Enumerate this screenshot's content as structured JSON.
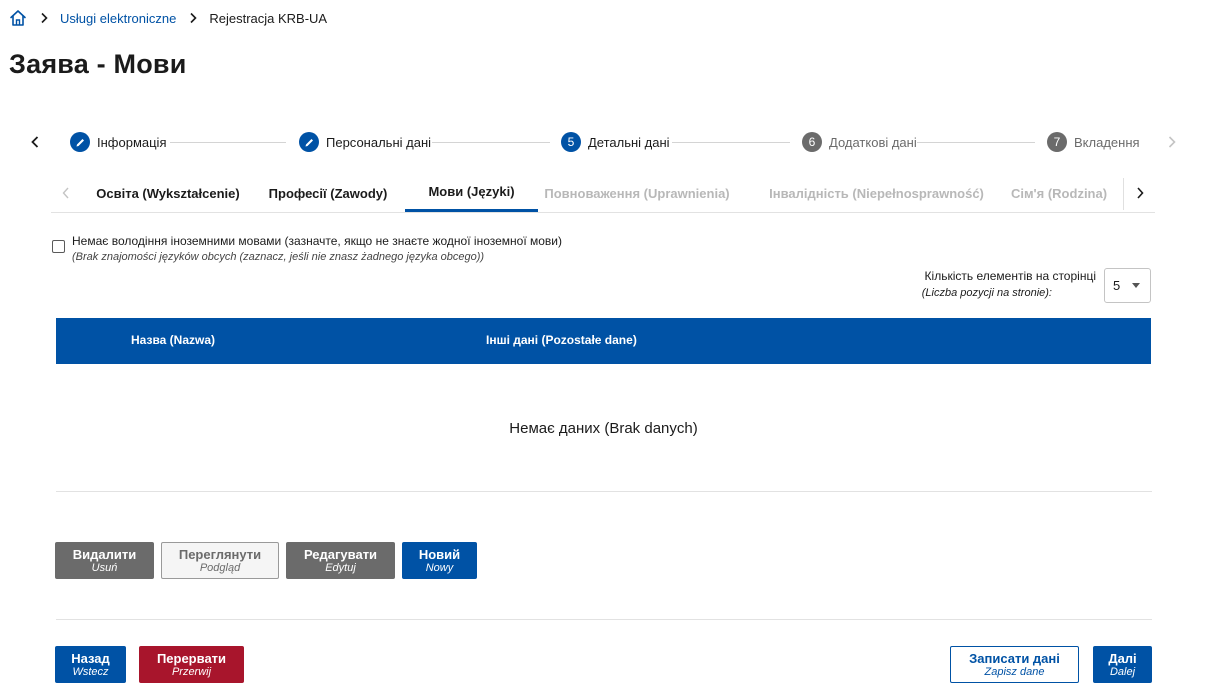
{
  "breadcrumb": {
    "home_icon": "home-icon",
    "items": [
      "Usługi elektroniczne",
      "Rejestracja KRB-UA"
    ]
  },
  "page_title": "Заява - Мови",
  "stepper": {
    "steps": [
      {
        "number": "",
        "icon": "pencil-icon",
        "label": "Інформація",
        "state": "completed"
      },
      {
        "number": "",
        "icon": "pencil-icon",
        "label": "Персональні дані",
        "state": "completed"
      },
      {
        "number": "5",
        "label": "Детальні дані",
        "state": "current"
      },
      {
        "number": "6",
        "label": "Додаткові дані",
        "state": "upcoming"
      },
      {
        "number": "7",
        "label": "Вкладення",
        "state": "upcoming"
      }
    ]
  },
  "tabs": [
    {
      "label": "Освіта (Wykształcenie)",
      "state": "enabled"
    },
    {
      "label": "Професії (Zawody)",
      "state": "enabled"
    },
    {
      "label": "Мови (Języki)",
      "state": "active"
    },
    {
      "label": "Повноваження (Uprawnienia)",
      "state": "disabled"
    },
    {
      "label": "Інвалідність (Niepełnosprawność)",
      "state": "disabled"
    },
    {
      "label": "Сім'я (Rodzina)",
      "state": "disabled"
    }
  ],
  "no_languages": {
    "label": "Немає володіння іноземними мовами (зазначте, якщо не знаєте жодної іноземної мови)",
    "sublabel": "(Brak znajomości języków obcych (zaznacz, jeśli nie znasz żadnego języka obcego))",
    "checked": false
  },
  "page_size": {
    "label": "Кількість елементів на сторінці",
    "sublabel": "(Liczba pozycji na stronie):",
    "value": "5"
  },
  "table": {
    "columns": [
      "Назва (Nazwa)",
      "Інші дані (Pozostałe dane)"
    ],
    "rows": [],
    "empty_message": "Немає даних (Brak danych)"
  },
  "actions": {
    "delete": {
      "label": "Видалити",
      "sub": "Usuń"
    },
    "view": {
      "label": "Переглянути",
      "sub": "Podgląd"
    },
    "edit": {
      "label": "Редагувати",
      "sub": "Edytuj"
    },
    "new": {
      "label": "Новий",
      "sub": "Nowy"
    }
  },
  "footer": {
    "back": {
      "label": "Назад",
      "sub": "Wstecz"
    },
    "abort": {
      "label": "Перервати",
      "sub": "Przerwij"
    },
    "save": {
      "label": "Записати дані",
      "sub": "Zapisz dane"
    },
    "next": {
      "label": "Далі",
      "sub": "Dalej"
    }
  },
  "colors": {
    "primary": "#0052a5",
    "danger": "#a8152c",
    "neutral": "#6b6b6b"
  }
}
